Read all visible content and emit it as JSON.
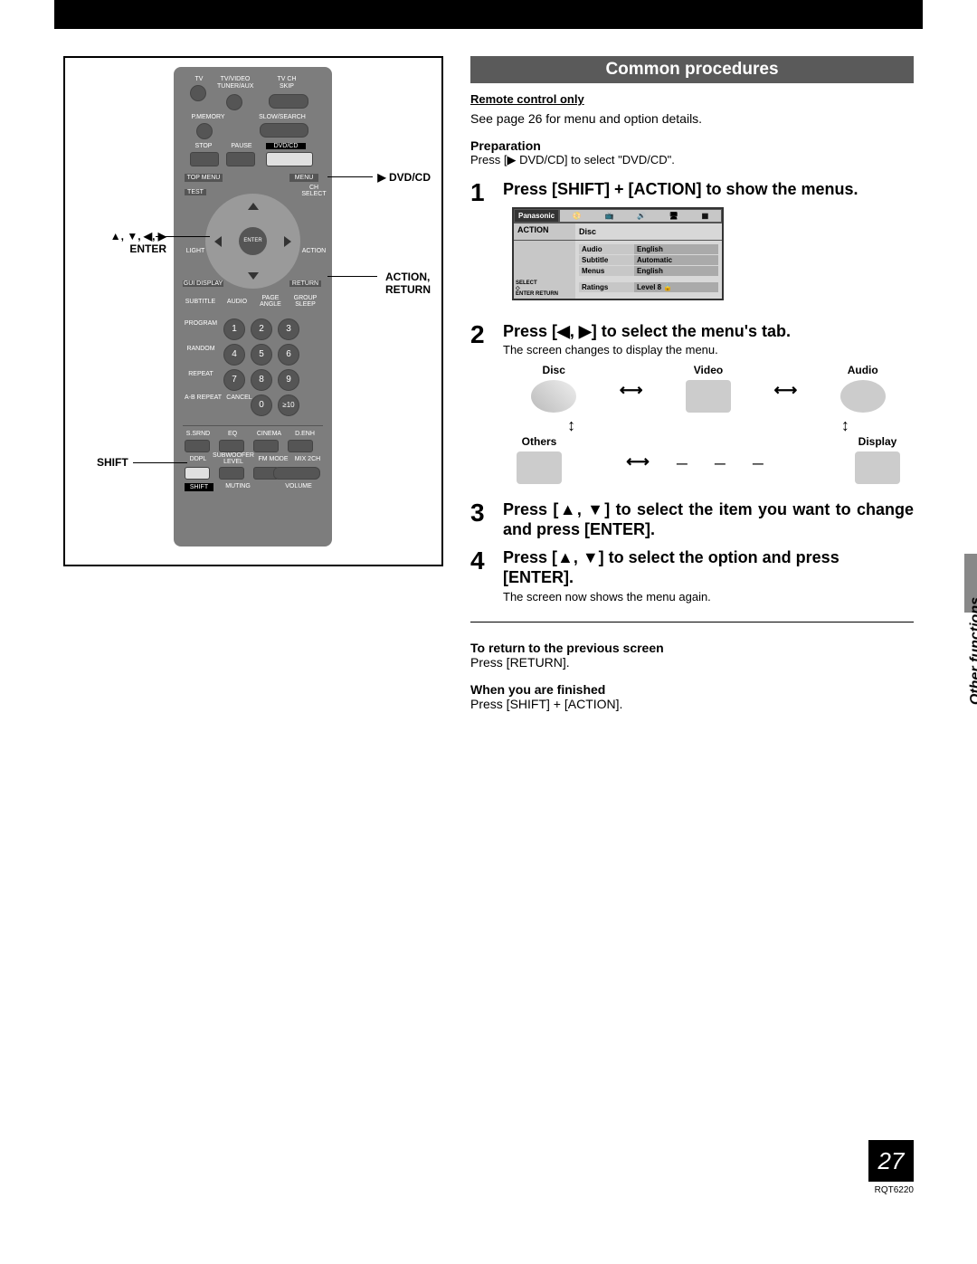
{
  "header": {
    "title": "Common procedures"
  },
  "intro": {
    "remote_only": "Remote control only",
    "see_page": "See page 26 for menu and option details.",
    "preparation_label": "Preparation",
    "preparation_text": "Press [▶ DVD/CD] to select \"DVD/CD\"."
  },
  "remote_callouts": {
    "dvdcd": "▶ DVD/CD",
    "arrows": "▲, ▼, ◀, ▶",
    "enter": "ENTER",
    "action": "ACTION,",
    "return": "RETURN",
    "shift": "SHIFT"
  },
  "remote_labels": {
    "tv": "TV",
    "tvvideo": "TV/VIDEO",
    "tvch": "TV CH",
    "tuneraux": "TUNER/AUX",
    "skip": "SKIP",
    "pmemory": "P.MEMORY",
    "slowsearch": "SLOW/SEARCH",
    "stop": "STOP",
    "pause": "PAUSE",
    "dvdcd": "DVD/CD",
    "topmenu": "TOP MENU",
    "menu": "MENU",
    "test": "TEST",
    "chselect": "CH SELECT",
    "enter": "ENTER",
    "light": "LIGHT",
    "action": "ACTION",
    "guidisplay": "GUI DISPLAY",
    "return": "RETURN",
    "subtitle": "SUBTITLE",
    "audio": "AUDIO",
    "pageangle": "PAGE ANGLE",
    "groupsleep": "GROUP SLEEP",
    "program": "PROGRAM",
    "random": "RANDOM",
    "repeat": "REPEAT",
    "abrepeat": "A-B REPEAT",
    "cancel": "CANCEL",
    "ssrnd": "S.SRND",
    "eq": "EQ",
    "cinema": "CINEMA",
    "denh": "D.ENH",
    "ddpl": "DDPL",
    "subwoofer": "SUBWOOFER LEVEL",
    "fmmode": "FM MODE",
    "mix2ch": "MIX 2CH",
    "shift": "SHIFT",
    "muting": "MUTING",
    "volume": "VOLUME"
  },
  "steps": [
    {
      "num": "1",
      "title": "Press [SHIFT] + [ACTION] to show the menus."
    },
    {
      "num": "2",
      "title": "Press [◀, ▶] to select the menu's tab.",
      "note": "The screen changes to display the menu."
    },
    {
      "num": "3",
      "title": "Press [▲, ▼] to select the item you want to change and press [ENTER]."
    },
    {
      "num": "4",
      "title": "Press [▲, ▼] to select the option and press [ENTER].",
      "note": "The screen now shows the menu again."
    }
  ],
  "tab_labels": {
    "disc": "Disc",
    "video": "Video",
    "audio": "Audio",
    "others": "Others",
    "display": "Display"
  },
  "osd": {
    "brand": "Panasonic",
    "action": "ACTION",
    "disc": "Disc",
    "items": [
      {
        "label": "Audio",
        "value": "English"
      },
      {
        "label": "Subtitle",
        "value": "Automatic"
      },
      {
        "label": "Menus",
        "value": "English"
      },
      {
        "label": "Ratings",
        "value": "Level 8 🔒"
      }
    ],
    "select": "SELECT",
    "enter": "ENTER",
    "return": "RETURN"
  },
  "footer": {
    "return_label": "To return to the previous screen",
    "return_text": "Press [RETURN].",
    "finished_label": "When you are finished",
    "finished_text": "Press [SHIFT] + [ACTION]."
  },
  "side_tab": "Other functions",
  "page_number": "27",
  "doc_id": "RQT6220"
}
